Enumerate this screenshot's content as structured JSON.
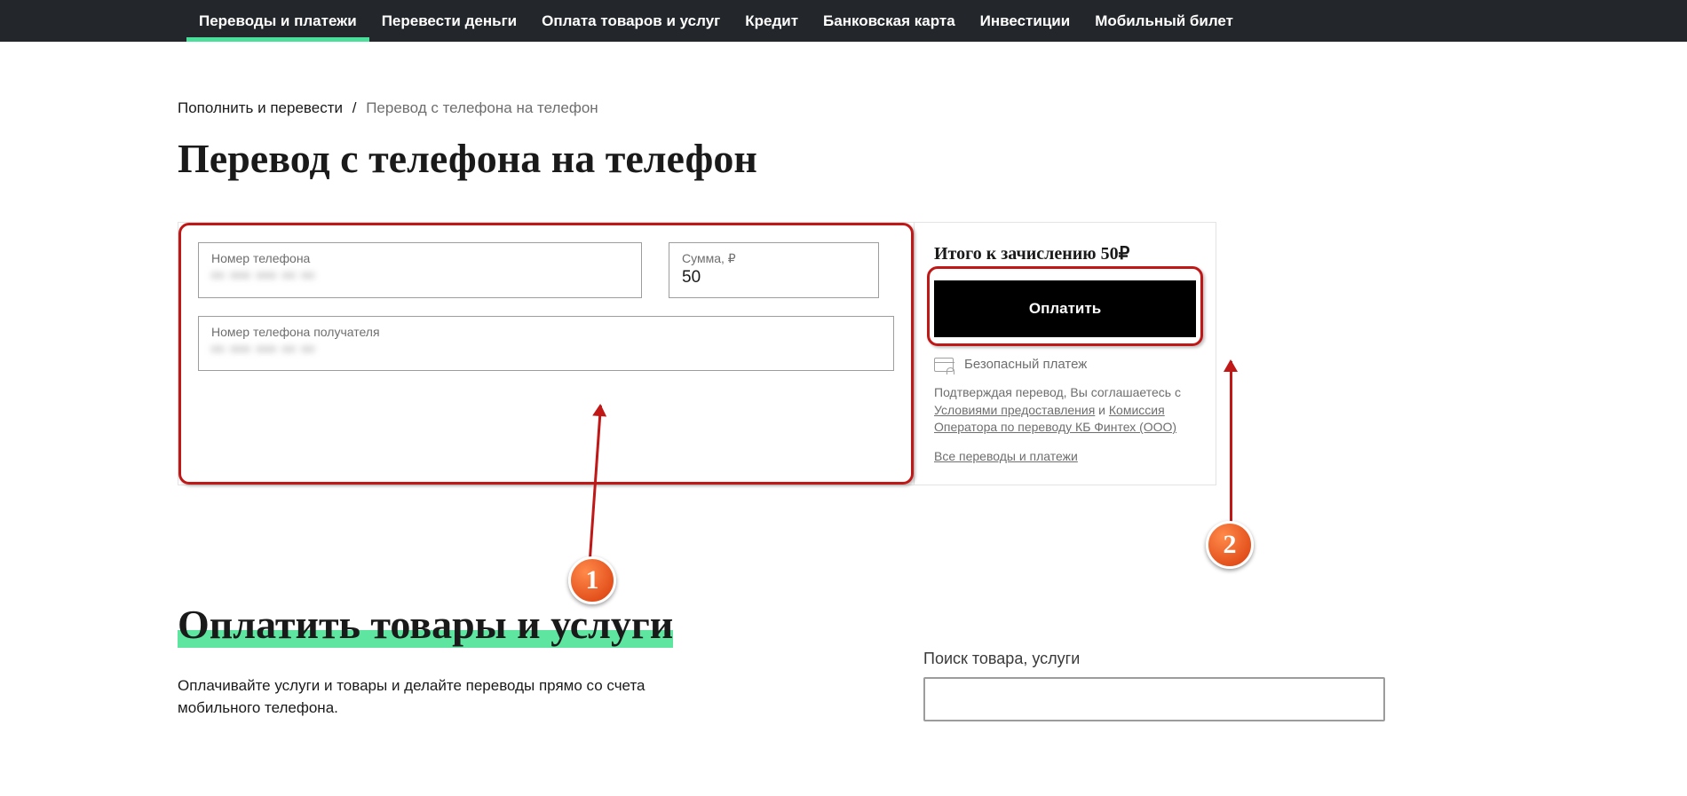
{
  "nav": {
    "items": [
      {
        "label": "Переводы и платежи",
        "active": true
      },
      {
        "label": "Перевести деньги"
      },
      {
        "label": "Оплата товаров и услуг"
      },
      {
        "label": "Кредит"
      },
      {
        "label": "Банковская карта"
      },
      {
        "label": "Инвестиции"
      },
      {
        "label": "Мобильный билет"
      }
    ]
  },
  "breadcrumb": {
    "parent": "Пополнить и перевести",
    "sep": "/",
    "current": "Перевод с телефона на телефон"
  },
  "page_title": "Перевод с телефона на телефон",
  "form": {
    "phone_from": {
      "label": "Номер телефона",
      "value": "•• ••• ••• •• ••"
    },
    "amount": {
      "label": "Сумма, ₽",
      "value": "50"
    },
    "phone_to": {
      "label": "Номер телефона получателя",
      "value": "•• ••• ••• •• ••"
    }
  },
  "summary": {
    "total_label": "Итого к зачислению 50₽",
    "pay_button": "Оплатить",
    "secure_label": "Безопасный платеж",
    "disclaimer_lead": "Подтверждая перевод, Вы соглашаетесь с ",
    "disclaimer_link1": "Условиями предоставления",
    "disclaimer_mid": " и ",
    "disclaimer_link2": "Комиссия Оператора по переводу КБ Финтех (ООО)",
    "all_link": "Все переводы и платежи"
  },
  "annotations": {
    "badge1": "1",
    "badge2": "2"
  },
  "section2": {
    "title": "Оплатить товары и услуги",
    "subtitle": "Оплачивайте услуги и товары и делайте переводы прямо со счета мобильного телефона.",
    "search_label": "Поиск товара, услуги"
  }
}
